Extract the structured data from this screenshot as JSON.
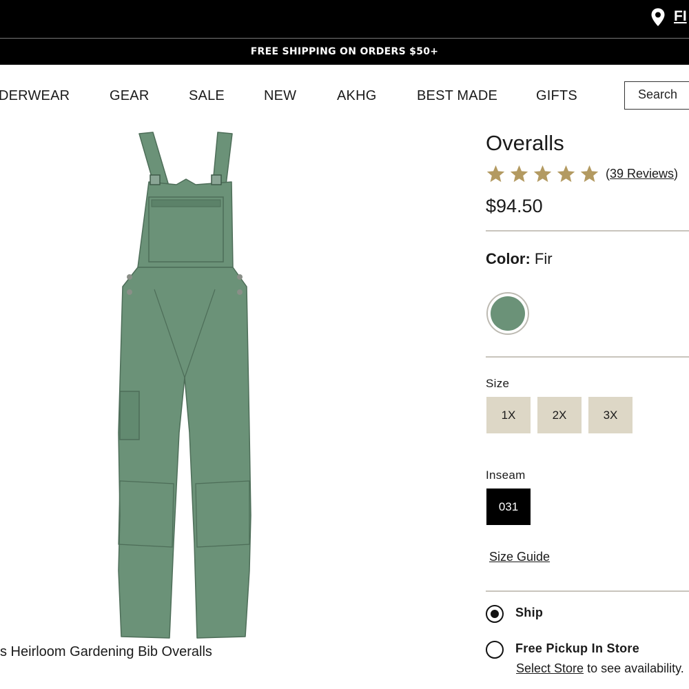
{
  "top_bar": {
    "find_label": "FI"
  },
  "promo": {
    "text": "FREE SHIPPING ON ORDERS $50+"
  },
  "nav": {
    "items": [
      "DERWEAR",
      "GEAR",
      "SALE",
      "NEW",
      "AKHG",
      "BEST MADE",
      "GIFTS"
    ],
    "search_label": "Search"
  },
  "product": {
    "caption": "s Heirloom Gardening Bib Overalls",
    "title": "Overalls",
    "rating_stars": 5,
    "reviews_text": "39 Reviews",
    "price": "$94.50",
    "color_label": "Color:",
    "color_value": "Fir",
    "swatch_color": "#6b9278",
    "size_label": "Size",
    "sizes": [
      "1X",
      "2X",
      "3X"
    ],
    "inseam_label": "Inseam",
    "inseam_selected": "031",
    "size_guide": "Size Guide"
  },
  "fulfillment": {
    "ship_label": "Ship",
    "pickup_label": "Free Pickup In Store",
    "select_store": "Select Store",
    "availability_text": " to see availability."
  },
  "colors": {
    "star": "#b39a61",
    "garment": "#6b9278",
    "size_bg": "#ddd7c6"
  }
}
